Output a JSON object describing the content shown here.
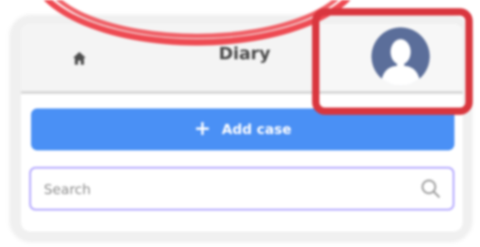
{
  "header": {
    "title": "Diary",
    "home_icon": "home-icon",
    "profile_icon": "avatar-icon"
  },
  "actions": {
    "add_case_label": "Add case",
    "add_case_icon": "plus-icon"
  },
  "search": {
    "placeholder": "Search",
    "value": "",
    "icon": "search-icon"
  },
  "colors": {
    "accent": "#4a90f5",
    "search_border": "#b3a7ff",
    "annotation": "#d9363e",
    "avatar_bg": "#5b6e9a"
  }
}
